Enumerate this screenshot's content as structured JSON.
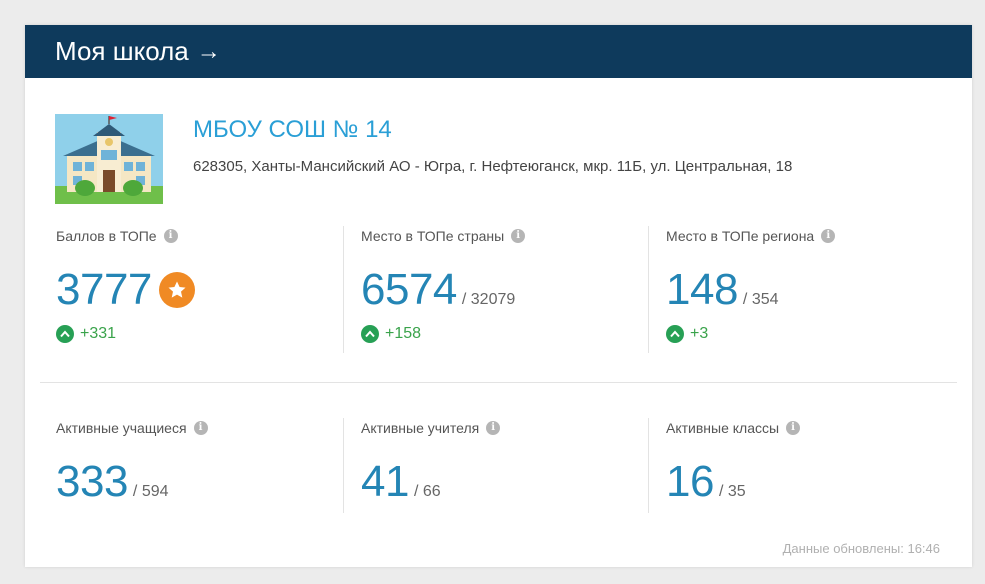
{
  "header": {
    "title": "Моя школа",
    "arrow": "→"
  },
  "school": {
    "name": "МБОУ СОШ № 14",
    "address": "628305, Ханты-Мансийский АО - Югра, г. Нефтеюганск, мкр. 11Б, ул. Центральная, 18",
    "image_icon": "school-building-icon"
  },
  "stats_top": [
    {
      "label": "Баллов в ТОПе",
      "value": "3777",
      "total": "",
      "delta": "+331"
    },
    {
      "label": "Место в ТОПе страны",
      "value": "6574",
      "total": "/ 32079",
      "delta": "+158"
    },
    {
      "label": "Место в ТОПе региона",
      "value": "148",
      "total": "/ 354",
      "delta": "+3"
    }
  ],
  "stats_bottom": [
    {
      "label": "Активные учащиеся",
      "value": "333",
      "total": "/ 594"
    },
    {
      "label": "Активные учителя",
      "value": "41",
      "total": "/ 66"
    },
    {
      "label": "Активные классы",
      "value": "16",
      "total": "/ 35"
    }
  ],
  "updated": "Данные обновлены: 16:46",
  "info_glyph": "i",
  "colors": {
    "header_bg": "#0e3a5c",
    "link": "#2a9fd6",
    "big_number": "#2485b5",
    "delta": "#3aa34b",
    "star_badge": "#f08a24"
  }
}
